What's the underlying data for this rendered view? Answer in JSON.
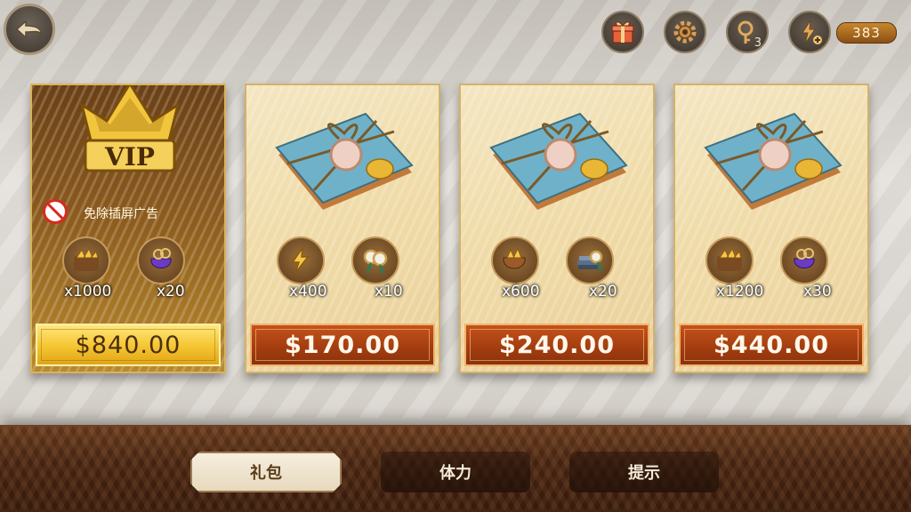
{
  "top_bar": {
    "back_icon": "back-arrow-icon",
    "gift_icon": "gift-icon",
    "settings_icon": "gear-icon",
    "key_icon": "magnifier-key-icon",
    "key_count": "3",
    "energy_icon": "lightning-plus-icon",
    "energy_value": "383"
  },
  "packs": [
    {
      "type": "vip",
      "badge": "VIP",
      "perk": "免除插屏广告",
      "items": [
        {
          "icon": "gold-bars-chest-icon",
          "qty": "x1000"
        },
        {
          "icon": "purple-bag-magnifier-icon",
          "qty": "x20"
        }
      ],
      "price": "$840.00"
    },
    {
      "type": "pack",
      "items": [
        {
          "icon": "lightning-energy-icon",
          "qty": "x400"
        },
        {
          "icon": "magnifier-hint-icon",
          "qty": "x10"
        }
      ],
      "price": "$170.00"
    },
    {
      "type": "pack",
      "items": [
        {
          "icon": "gold-bag-icon",
          "qty": "x600"
        },
        {
          "icon": "books-magnifier-icon",
          "qty": "x20"
        }
      ],
      "price": "$240.00"
    },
    {
      "type": "pack",
      "items": [
        {
          "icon": "gold-bars-chest-icon",
          "qty": "x1200"
        },
        {
          "icon": "purple-bag-magnifier-icon",
          "qty": "x30"
        }
      ],
      "price": "$440.00"
    }
  ],
  "tabs": [
    {
      "label": "礼包",
      "active": true
    },
    {
      "label": "体力",
      "active": false
    },
    {
      "label": "提示",
      "active": false
    }
  ],
  "colors": {
    "price_red": "#a53e10",
    "price_gold": "#f5c431",
    "card_cream": "#f0dca9",
    "bottom_bar": "#4a2613"
  }
}
